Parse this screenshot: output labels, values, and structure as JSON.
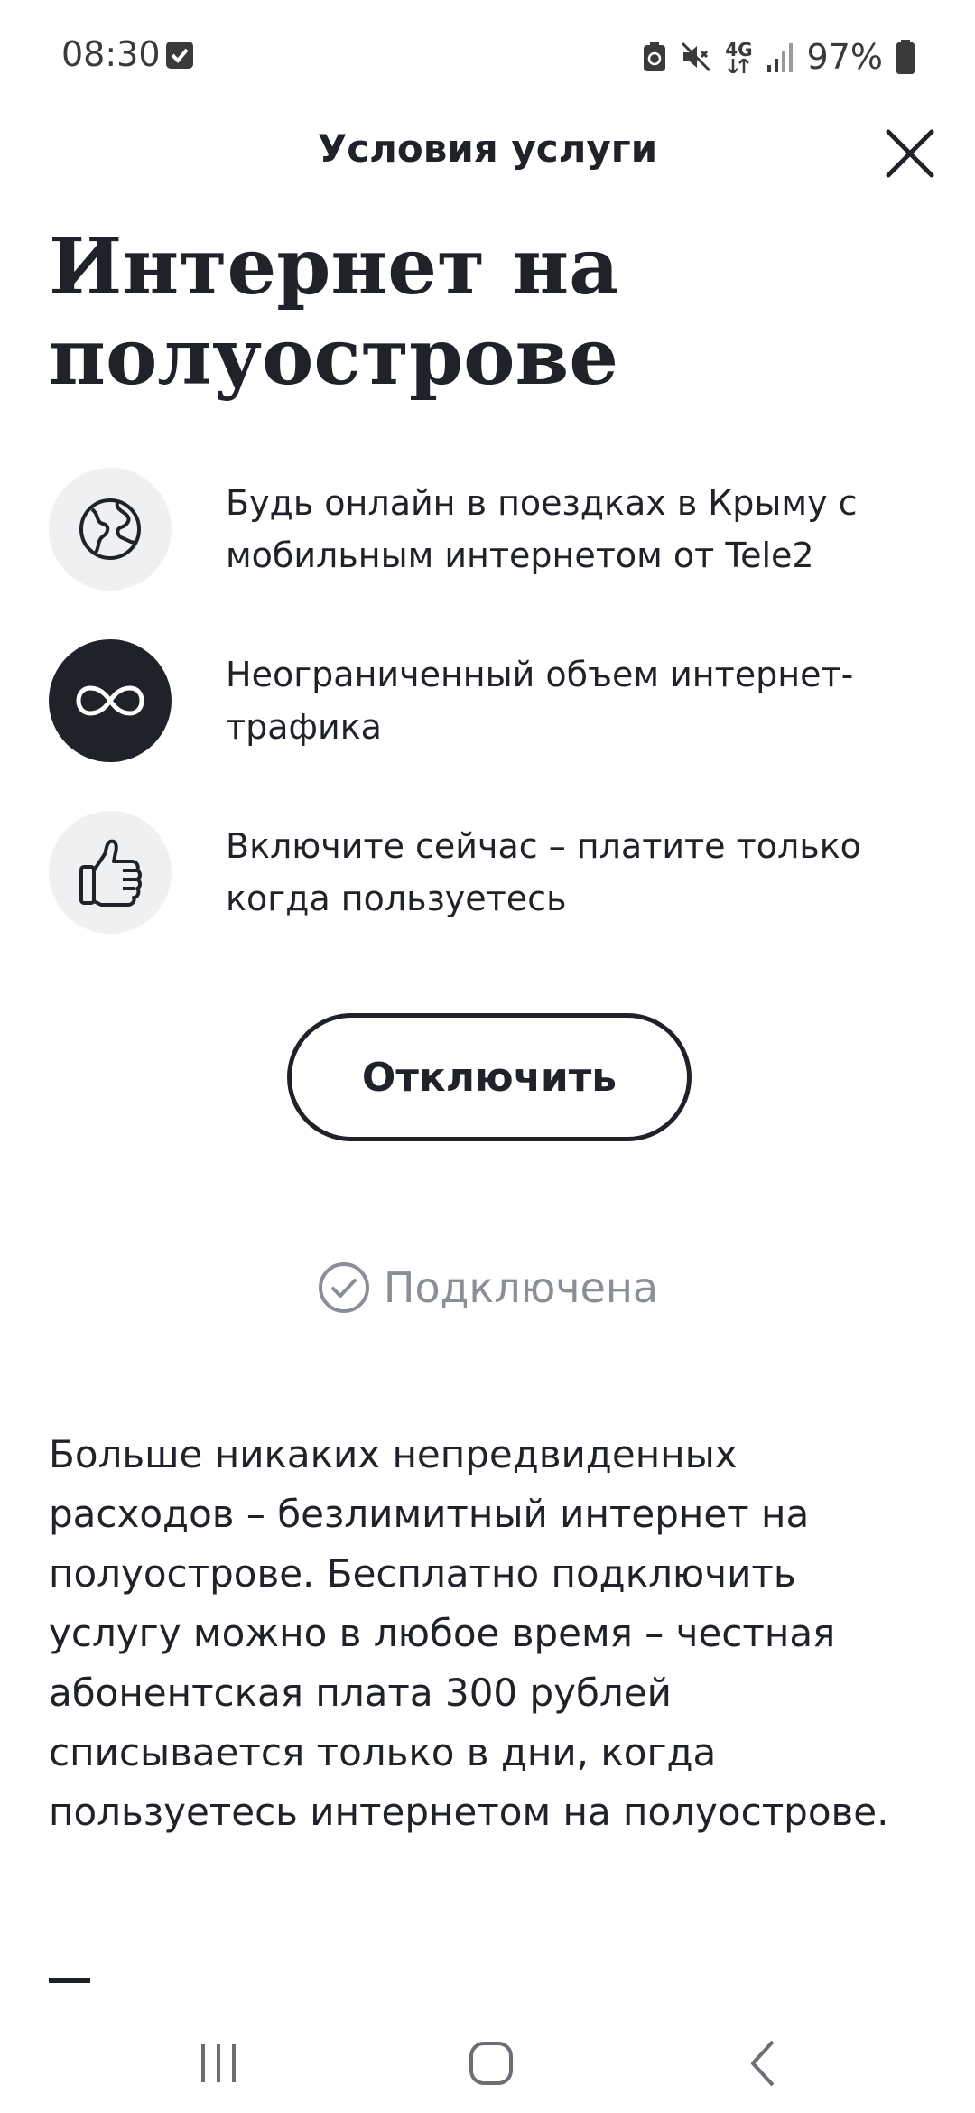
{
  "status_bar": {
    "time": "08:30",
    "network": "4G",
    "battery": "97%",
    "icons": [
      "checkbox-notification-icon",
      "battery-saver-icon",
      "mute-icon",
      "network-4g-icon",
      "signal-icon",
      "battery-icon"
    ]
  },
  "header": {
    "title": "Условия услуги",
    "close_icon": "close-icon"
  },
  "page_title": {
    "line1": "Интернет на",
    "line2": "полуострове"
  },
  "features": [
    {
      "icon": "globe-icon",
      "text": "Будь онлайн в поездках в Крыму с мобильным интернетом от Tele2"
    },
    {
      "icon": "infinity-icon",
      "text": "Неограниченный объем интернет-трафика"
    },
    {
      "icon": "thumbs-up-icon",
      "text": "Включите сейчас – платите только когда пользуетесь"
    }
  ],
  "action_button": {
    "label": "Отключить"
  },
  "service_status": {
    "label": "Подключена",
    "icon": "check-circle-icon"
  },
  "description": "Больше никаких непредвиденных расходов – безлимитный интернет на полуострове. Бесплатно подключить услугу можно в любое время – честная абонентская плата 300 рублей списывается только в дни, когда пользуетесь интернетом на полуострове.",
  "nav_bar": {
    "icons": [
      "recent-apps-icon",
      "home-icon",
      "back-icon"
    ]
  },
  "colors": {
    "text": "#1f2229",
    "muted": "#8a8e96",
    "icon_bg": "#eef0f2"
  }
}
